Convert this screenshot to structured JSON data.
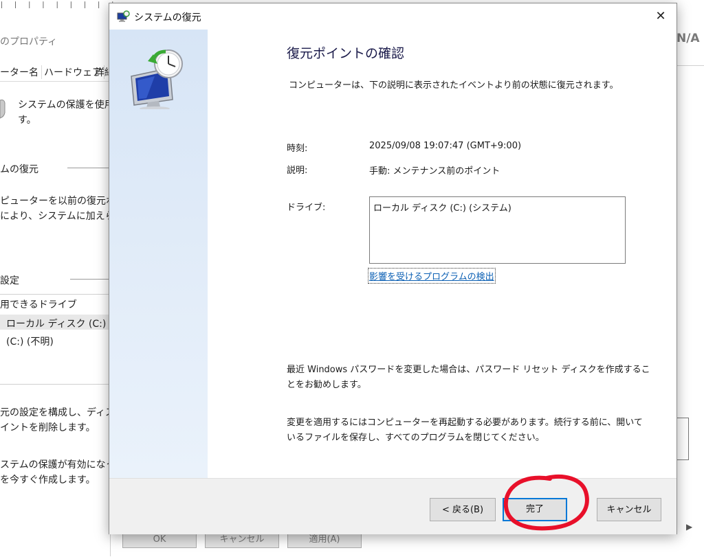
{
  "background_window": {
    "title_partial": "のプロパティ",
    "tabs": [
      "ーター名",
      "ハードウェア",
      "詳細"
    ],
    "protection_text_line1": "システムの保護を使用",
    "protection_text_line2": "す。",
    "section_restore": "ムの復元",
    "restore_text_line1": "ピューターを以前の復元ポイ",
    "restore_text_line2": "により、システムに加えられ",
    "section_settings": "設定",
    "drives_header": "用できるドライブ",
    "drive_1": "ローカル ディスク (C:) (シス",
    "drive_2": "(C:) (不明)",
    "configure_text_line1": "元の設定を構成し、ディス",
    "configure_text_line2": "イントを削除します。",
    "create_text_line1": "ステムの保護が有効になっ",
    "create_text_line2": "を今すぐ作成します。",
    "buttons": [
      "OK",
      "キャンセル",
      "適用(A)"
    ],
    "right_partial_text": "N/A"
  },
  "dialog": {
    "title": "システムの復元",
    "close_glyph": "✕",
    "heading": "復元ポイントの確認",
    "intro": "コンピューターは、下の説明に表示されたイベントより前の状態に復元されます。",
    "time_label": "時刻:",
    "time_value": "2025/09/08 19:07:47 (GMT+9:00)",
    "description_label": "説明:",
    "description_value": "手動: メンテナンス前のポイント",
    "drives_label": "ドライブ:",
    "drive_item": "ローカル ディスク (C:) (システム)",
    "scan_link": "影響を受けるプログラムの検出",
    "password_note": "最近 Windows パスワードを変更した場合は、パスワード リセット ディスクを作成することをお勧めします。",
    "restart_note": "変更を適用するにはコンピューターを再起動する必要があります。続行する前に、開いているファイルを保存し、すべてのプログラムを閉じてください。",
    "back_button": "< 戻る(B)",
    "finish_button": "完了",
    "cancel_button": "キャンセル"
  },
  "colors": {
    "accent": "#0078d7",
    "annotation": "#e8102a",
    "link": "#0a5fb4",
    "side_panel": "#dbe8f7"
  },
  "icons": {
    "title_icon": "system-restore-icon",
    "side_art": "restore-monitor-clock-icon"
  }
}
